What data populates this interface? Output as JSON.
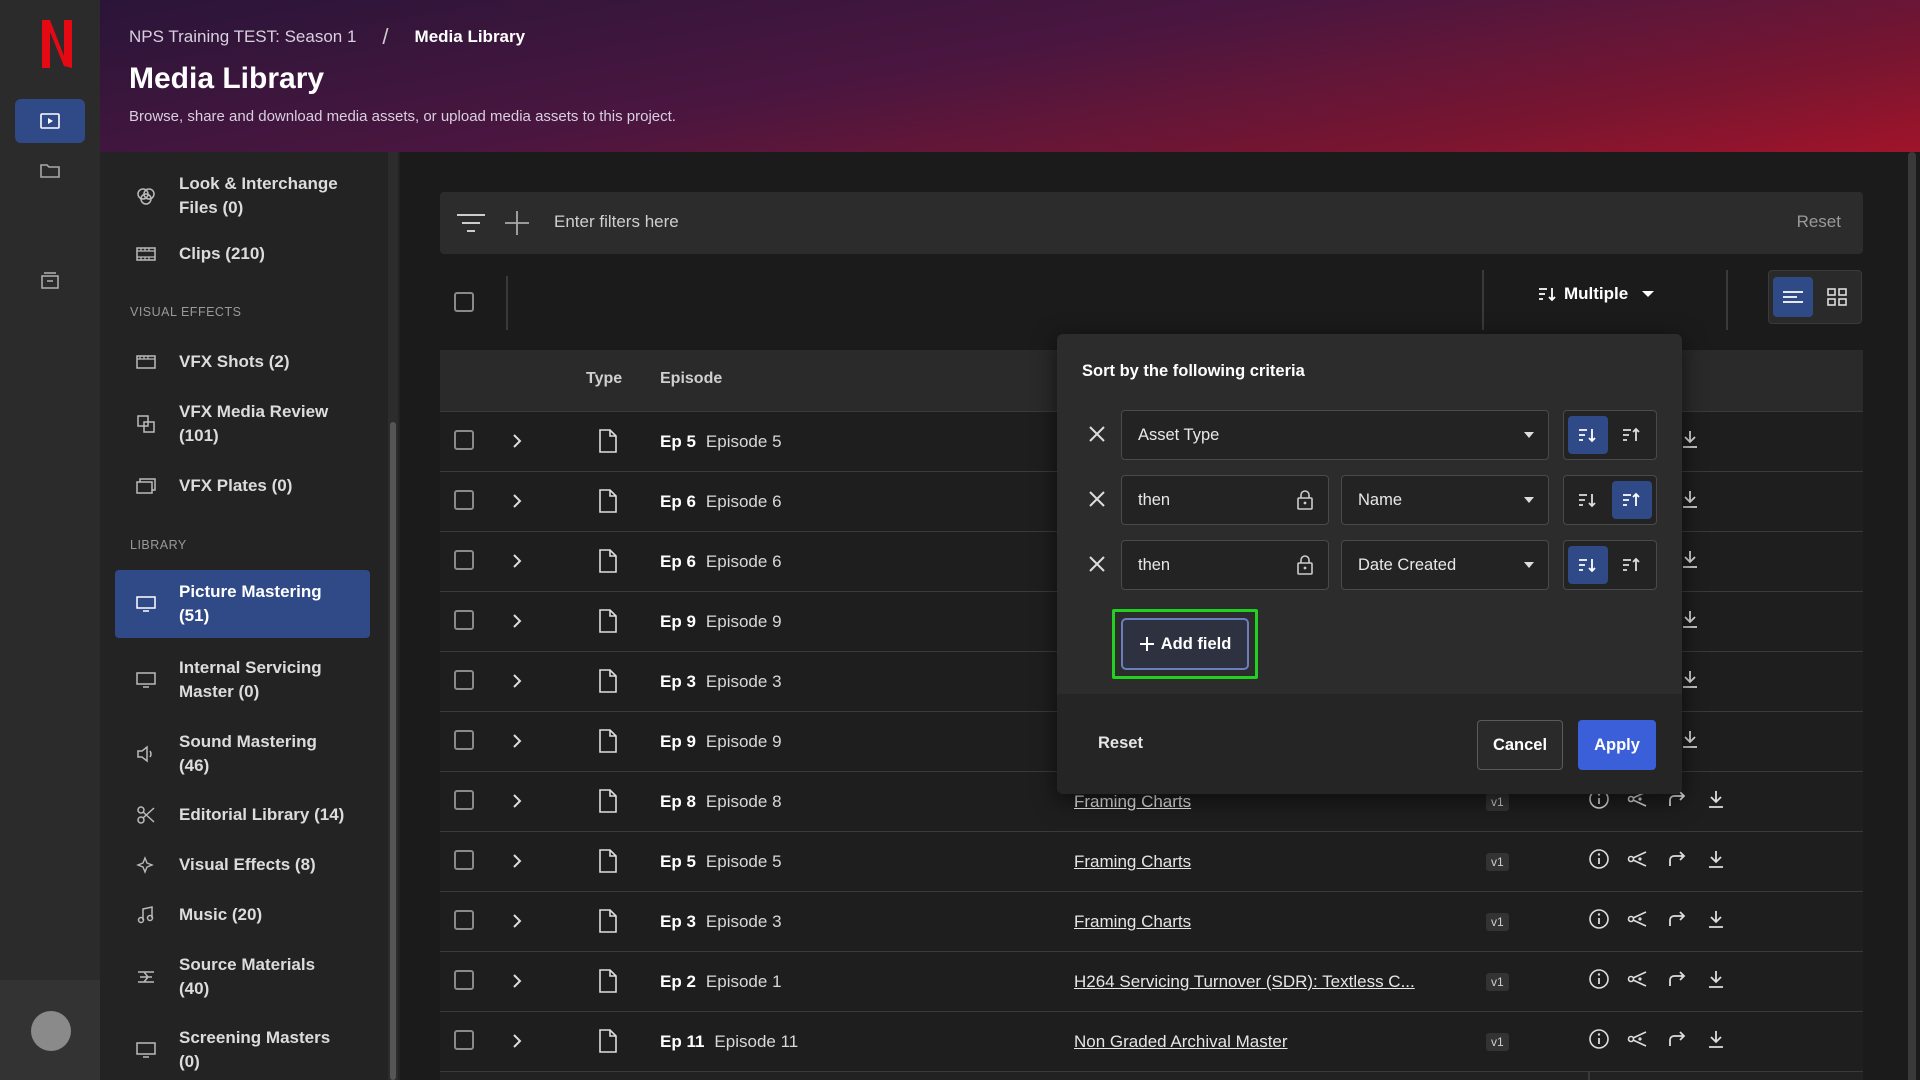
{
  "breadcrumb": {
    "project": "NPS Training TEST: Season 1",
    "separator": "/",
    "current": "Media Library"
  },
  "page": {
    "title": "Media Library",
    "subtitle": "Browse, share and download media assets, or upload media assets to this project."
  },
  "sidebar": {
    "items": [
      {
        "label": "Look & Interchange",
        "label2": "Files (0)",
        "icon": "circles-icon"
      },
      {
        "label": "Clips (210)",
        "icon": "film-icon"
      },
      {
        "section": "VISUAL EFFECTS"
      },
      {
        "label": "VFX Shots (2)",
        "icon": "film-frame-icon"
      },
      {
        "label": "VFX Media Review",
        "label2": "(101)",
        "icon": "review-icon"
      },
      {
        "label": "VFX Plates (0)",
        "icon": "plates-icon"
      },
      {
        "section": "LIBRARY"
      },
      {
        "label": "Picture Mastering",
        "label2": "(51)",
        "icon": "monitor-icon",
        "active": true
      },
      {
        "label": "Internal Servicing",
        "label2": "Master (0)",
        "icon": "monitor-icon"
      },
      {
        "label": "Sound Mastering",
        "label2": "(46)",
        "icon": "speaker-icon"
      },
      {
        "label": "Editorial Library (14)",
        "icon": "scissors-icon"
      },
      {
        "label": "Visual Effects (8)",
        "icon": "sparkle-icon"
      },
      {
        "label": "Music (20)",
        "icon": "music-icon"
      },
      {
        "label": "Source Materials",
        "label2": "(40)",
        "icon": "stack-icon"
      },
      {
        "label": "Screening Masters",
        "label2": "(0)",
        "icon": "monitor-icon"
      }
    ]
  },
  "filter": {
    "placeholder": "Enter filters here",
    "reset": "Reset"
  },
  "toolbar": {
    "sort_label": "Multiple"
  },
  "table": {
    "headers": {
      "type": "Type",
      "episode": "Episode"
    },
    "rows": [
      {
        "ep": "Ep 5",
        "episode": "Episode 5",
        "name": "",
        "version": ""
      },
      {
        "ep": "Ep 6",
        "episode": "Episode 6",
        "name": "",
        "version": ""
      },
      {
        "ep": "Ep 6",
        "episode": "Episode 6",
        "name": "",
        "version": ""
      },
      {
        "ep": "Ep 9",
        "episode": "Episode 9",
        "name": "",
        "version": ""
      },
      {
        "ep": "Ep 3",
        "episode": "Episode 3",
        "name": "",
        "version": ""
      },
      {
        "ep": "Ep 9",
        "episode": "Episode 9",
        "name": "",
        "version": ""
      },
      {
        "ep": "Ep 8",
        "episode": "Episode 8",
        "name": "Framing Charts",
        "version": "v1"
      },
      {
        "ep": "Ep 5",
        "episode": "Episode 5",
        "name": "Framing Charts",
        "version": "v1"
      },
      {
        "ep": "Ep 3",
        "episode": "Episode 3",
        "name": "Framing Charts",
        "version": "v1"
      },
      {
        "ep": "Ep 2",
        "episode": "Episode 1",
        "name": "H264 Servicing Turnover (SDR): Textless C...",
        "version": "v1"
      },
      {
        "ep": "Ep 11",
        "episode": "Episode 11",
        "name": "Non Graded Archival Master",
        "version": "v1"
      }
    ]
  },
  "sort_popover": {
    "title": "Sort by the following criteria",
    "rows": [
      {
        "field": "Asset Type",
        "direction": "descending"
      },
      {
        "prefix": "then",
        "field": "Name",
        "direction": "ascending"
      },
      {
        "prefix": "then",
        "field": "Date Created",
        "direction": "descending"
      }
    ],
    "add_field": "Add field",
    "reset": "Reset",
    "cancel": "Cancel",
    "apply": "Apply"
  },
  "colors": {
    "accent": "#3b5fd9",
    "active_bg": "#2f4a86",
    "highlight": "#22d022",
    "brand_red": "#e50914"
  }
}
